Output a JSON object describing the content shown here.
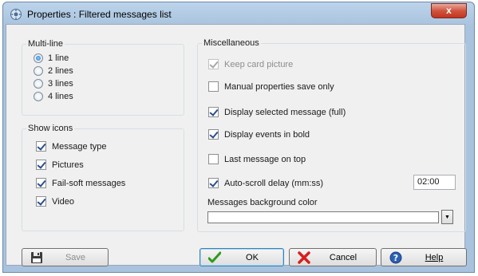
{
  "window": {
    "title": "Properties : Filtered messages list",
    "close_glyph": "x"
  },
  "multiline": {
    "legend": "Multi-line",
    "options": [
      "1 line",
      "2 lines",
      "3 lines",
      "4 lines"
    ],
    "selected": "1 line"
  },
  "show_icons": {
    "legend": "Show icons",
    "items": [
      {
        "label": "Message type",
        "checked": true
      },
      {
        "label": "Pictures",
        "checked": true
      },
      {
        "label": "Fail-soft messages",
        "checked": true
      },
      {
        "label": "Video",
        "checked": true
      }
    ]
  },
  "misc": {
    "legend": "Miscellaneous",
    "items": [
      {
        "label": "Keep card picture",
        "checked": true,
        "disabled": true
      },
      {
        "label": "Manual properties save only",
        "checked": false
      },
      {
        "label": "Display selected message (full)",
        "checked": true
      },
      {
        "label": "Display events in bold",
        "checked": true
      },
      {
        "label": "Last message on top",
        "checked": false
      },
      {
        "label": "Auto-scroll delay (mm:ss)",
        "checked": true
      }
    ],
    "autoscroll_value": "02:00",
    "bg_color_label": "Messages background color",
    "bg_color_value": ""
  },
  "buttons": {
    "save": "Save",
    "ok": "OK",
    "cancel": "Cancel",
    "help": "Help"
  },
  "icons": {
    "app": "gear-shield-icon",
    "save": "floppy-disk-icon",
    "ok": "green-check-icon",
    "cancel": "red-x-icon",
    "help": "help-question-icon",
    "combo": "dropdown-arrow-icon"
  },
  "colors": {
    "titlebar": "#a9c3de",
    "close": "#c2341e",
    "ok_check": "#2e9a1a",
    "cancel_x": "#d61f1f",
    "help_blue": "#2b5fb3"
  }
}
